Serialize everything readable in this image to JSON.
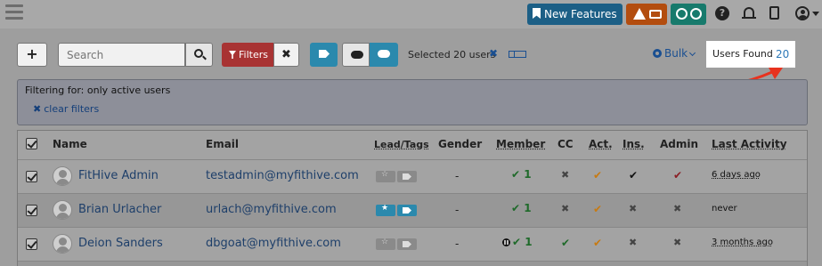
{
  "topbar": {
    "new_features_label": "New Features",
    "icons": [
      "menu-icon",
      "bookmark-icon",
      "warning-icon",
      "credit-card-icon",
      "clock-icon",
      "play-icon",
      "help-icon",
      "bell-icon",
      "phone-icon",
      "user-icon",
      "caret-down-icon"
    ],
    "colors": {
      "new_features": "#1c5f86",
      "alert": "#b34d0f",
      "clock": "#177a6c"
    }
  },
  "toolbar": {
    "add_label": "+",
    "search_placeholder": "Search",
    "filters_label": "Filters",
    "clear_filters_x": "✖",
    "selected_text": "Selected 20 users",
    "selected_clear": "✖",
    "bulk_label": "Bulk",
    "users_found_label": "Users Found",
    "users_found_count": "20"
  },
  "filter_box": {
    "text": "Filtering for: only active users",
    "clear_label": "clear filters",
    "clear_icon": "✖"
  },
  "table": {
    "headers": {
      "name": "Name",
      "email": "Email",
      "lead_tags": "Lead/Tags",
      "gender": "Gender",
      "member": "Member",
      "cc": "CC",
      "act": "Act.",
      "ins": "Ins.",
      "admin": "Admin",
      "last_activity": "Last Activity"
    },
    "rows": [
      {
        "name": "FitHive Admin",
        "email": "testadmin@myfithive.com",
        "gender": "-",
        "member": "✔ 1",
        "cc": "✖",
        "act": "✔",
        "ins": "✔",
        "admin": "✔",
        "last_activity": "6 days ago",
        "starred": false,
        "tagged": false
      },
      {
        "name": "Brian Urlacher",
        "email": "urlach@myfithive.com",
        "gender": "-",
        "member": "✔ 1",
        "cc": "✖",
        "act": "✔",
        "ins": "✖",
        "admin": "✖",
        "last_activity": "never",
        "starred": true,
        "tagged": true
      },
      {
        "name": "Deion Sanders",
        "email": "dbgoat@myfithive.com",
        "gender": "-",
        "member": "✔ 1",
        "cc": "✔",
        "act": "✔",
        "ins": "✖",
        "admin": "✖",
        "last_activity": "3 months ago",
        "starred": false,
        "tagged": false
      }
    ]
  }
}
